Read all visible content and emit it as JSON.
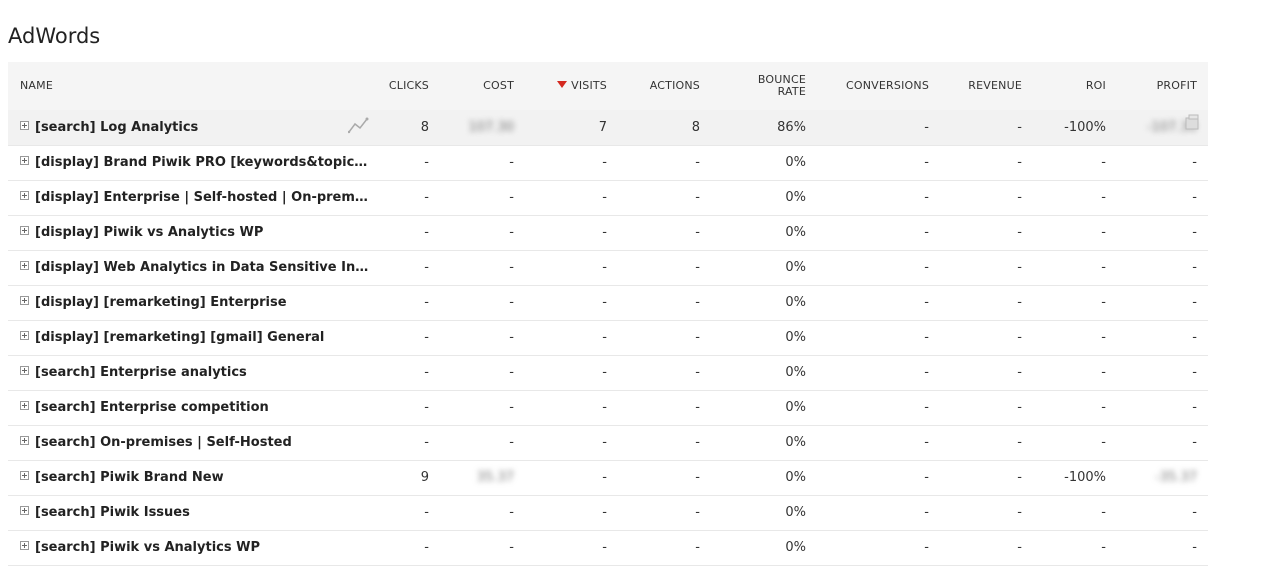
{
  "report": {
    "title": "AdWords",
    "sorted_column_icon": "sort-desc-icon",
    "columns": {
      "name": "NAME",
      "clicks": "CLICKS",
      "cost": "COST",
      "visits": "VISITS",
      "actions": "ACTIONS",
      "bounce_rate": "BOUNCE RATE",
      "conversions": "CONVERSIONS",
      "revenue": "REVENUE",
      "roi": "ROI",
      "profit": "PROFIT"
    },
    "rows": [
      {
        "name": "[search] Log Analytics",
        "clicks": "8",
        "cost": "107.30",
        "visits": "7",
        "actions": "8",
        "bounce_rate": "86%",
        "conversions": "-",
        "revenue": "-",
        "roi": "-100%",
        "profit": "-107.30"
      },
      {
        "name": "[display] Brand Piwik PRO [keywords&topic…",
        "clicks": "-",
        "cost": "-",
        "visits": "-",
        "actions": "-",
        "bounce_rate": "0%",
        "conversions": "-",
        "revenue": "-",
        "roi": "-",
        "profit": "-"
      },
      {
        "name": "[display] Enterprise | Self-hosted | On-prem…",
        "clicks": "-",
        "cost": "-",
        "visits": "-",
        "actions": "-",
        "bounce_rate": "0%",
        "conversions": "-",
        "revenue": "-",
        "roi": "-",
        "profit": "-"
      },
      {
        "name": "[display] Piwik vs Analytics WP",
        "clicks": "-",
        "cost": "-",
        "visits": "-",
        "actions": "-",
        "bounce_rate": "0%",
        "conversions": "-",
        "revenue": "-",
        "roi": "-",
        "profit": "-"
      },
      {
        "name": "[display] Web Analytics in Data Sensitive In…",
        "clicks": "-",
        "cost": "-",
        "visits": "-",
        "actions": "-",
        "bounce_rate": "0%",
        "conversions": "-",
        "revenue": "-",
        "roi": "-",
        "profit": "-"
      },
      {
        "name": "[display] [remarketing] Enterprise",
        "clicks": "-",
        "cost": "-",
        "visits": "-",
        "actions": "-",
        "bounce_rate": "0%",
        "conversions": "-",
        "revenue": "-",
        "roi": "-",
        "profit": "-"
      },
      {
        "name": "[display] [remarketing] [gmail] General",
        "clicks": "-",
        "cost": "-",
        "visits": "-",
        "actions": "-",
        "bounce_rate": "0%",
        "conversions": "-",
        "revenue": "-",
        "roi": "-",
        "profit": "-"
      },
      {
        "name": "[search] Enterprise analytics",
        "clicks": "-",
        "cost": "-",
        "visits": "-",
        "actions": "-",
        "bounce_rate": "0%",
        "conversions": "-",
        "revenue": "-",
        "roi": "-",
        "profit": "-"
      },
      {
        "name": "[search] Enterprise competition",
        "clicks": "-",
        "cost": "-",
        "visits": "-",
        "actions": "-",
        "bounce_rate": "0%",
        "conversions": "-",
        "revenue": "-",
        "roi": "-",
        "profit": "-"
      },
      {
        "name": "[search] On-premises | Self-Hosted",
        "clicks": "-",
        "cost": "-",
        "visits": "-",
        "actions": "-",
        "bounce_rate": "0%",
        "conversions": "-",
        "revenue": "-",
        "roi": "-",
        "profit": "-"
      },
      {
        "name": "[search] Piwik Brand New",
        "clicks": "9",
        "cost": "35.37",
        "visits": "-",
        "actions": "-",
        "bounce_rate": "0%",
        "conversions": "-",
        "revenue": "-",
        "roi": "-100%",
        "profit": "-35.37"
      },
      {
        "name": "[search] Piwik Issues",
        "clicks": "-",
        "cost": "-",
        "visits": "-",
        "actions": "-",
        "bounce_rate": "0%",
        "conversions": "-",
        "revenue": "-",
        "roi": "-",
        "profit": "-"
      },
      {
        "name": "[search] Piwik vs Analytics WP",
        "clicks": "-",
        "cost": "-",
        "visits": "-",
        "actions": "-",
        "bounce_rate": "0%",
        "conversions": "-",
        "revenue": "-",
        "roi": "-",
        "profit": "-"
      }
    ]
  },
  "colors": {
    "header_bg": "#f5f5f5",
    "highlight_row_bg": "#f2f2f2",
    "sort_arrow": "#d4291f",
    "row_border": "#e8e8e8"
  }
}
